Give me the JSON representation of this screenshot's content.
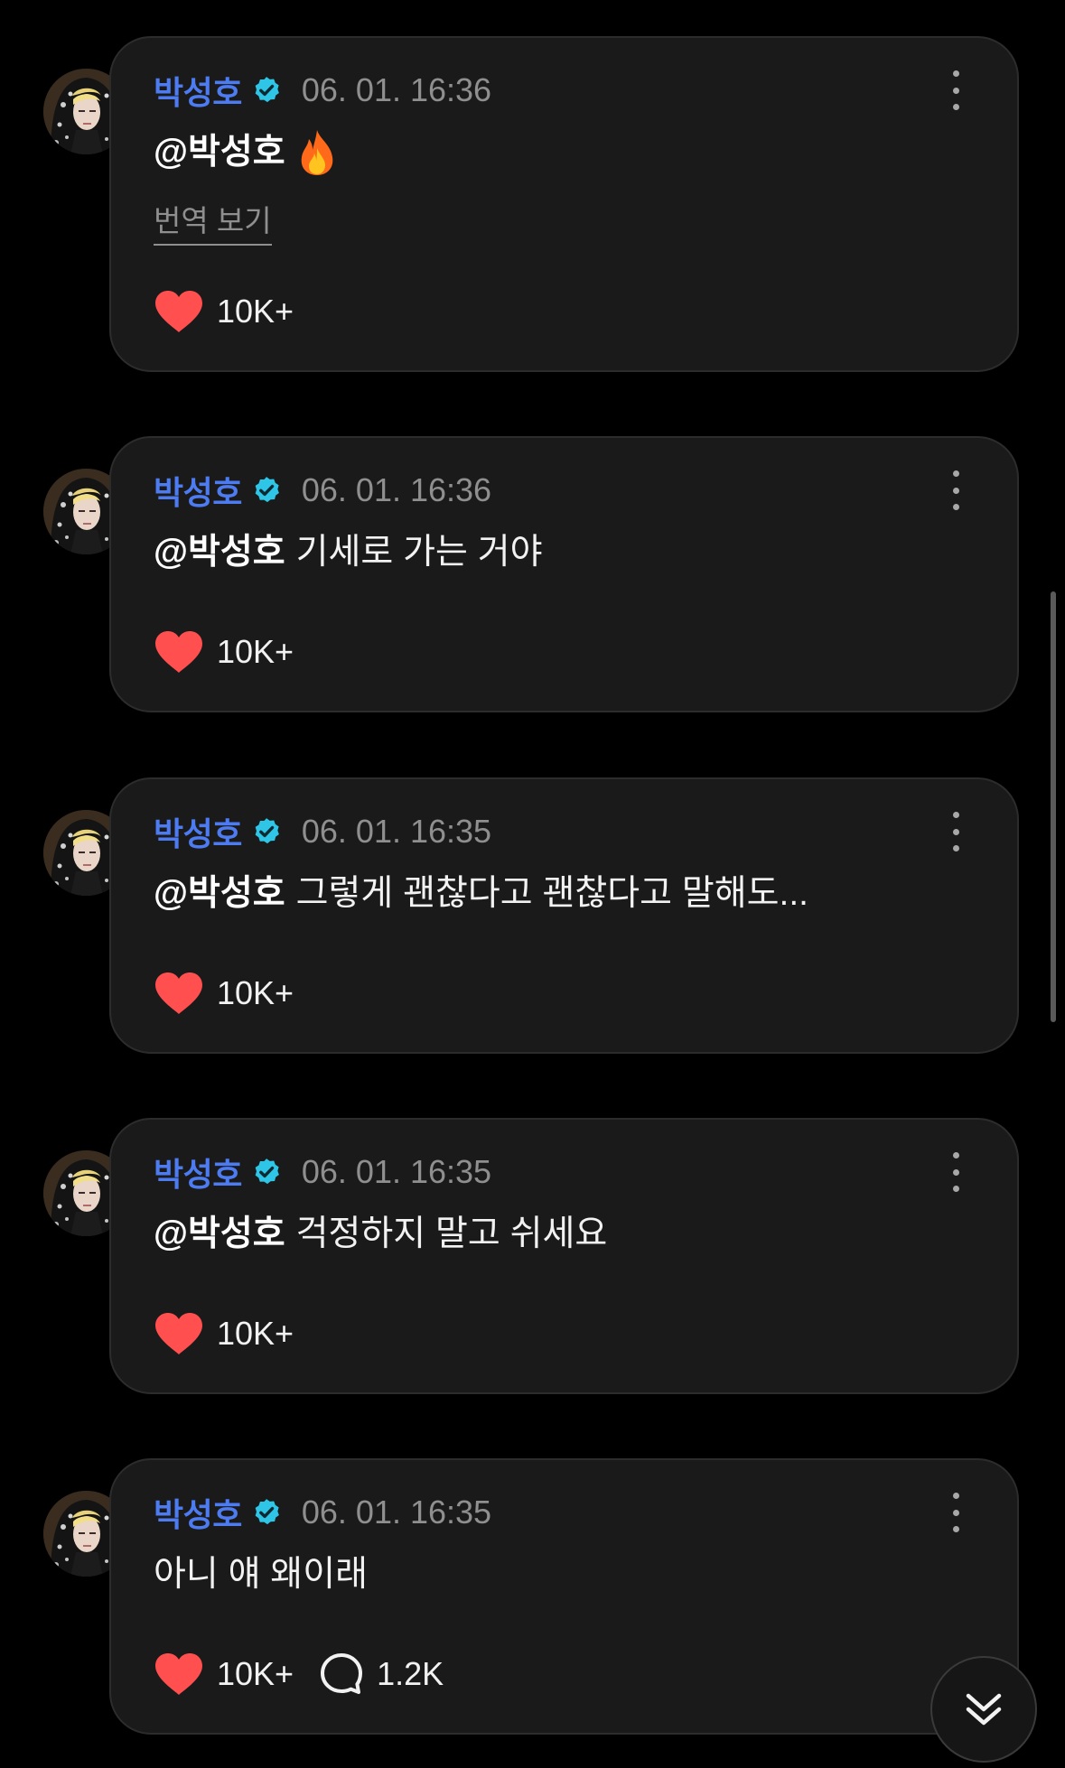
{
  "colors": {
    "background": "#000000",
    "card": "#1a1a1a",
    "author": "#4d7cf2",
    "verified": "#2ec5e6",
    "like": "#ff4f4f",
    "muted": "#8f8f8f"
  },
  "icons": {
    "verified": "verified-badge-icon",
    "more": "more-vertical-icon",
    "like": "heart-icon",
    "reply": "speech-bubble-icon",
    "scroll": "double-chevron-down-icon",
    "emoji": "fire-emoji"
  },
  "comments": [
    {
      "author": "박성호",
      "timestamp": "06. 01. 16:36",
      "mention": "@박성호",
      "text": "",
      "translate_label": "번역 보기",
      "likes": "10K+"
    },
    {
      "author": "박성호",
      "timestamp": "06. 01. 16:36",
      "mention": "@박성호",
      "text": "기세로 가는 거야",
      "likes": "10K+"
    },
    {
      "author": "박성호",
      "timestamp": "06. 01. 16:35",
      "mention": "@박성호",
      "text": "그렇게 괜찮다고 괜찮다고 말해도...",
      "likes": "10K+"
    },
    {
      "author": "박성호",
      "timestamp": "06. 01. 16:35",
      "mention": "@박성호",
      "text": "걱정하지 말고 쉬세요",
      "likes": "10K+"
    },
    {
      "author": "박성호",
      "timestamp": "06. 01. 16:35",
      "mention": "",
      "text": "아니 얘 왜이래",
      "likes": "10K+",
      "replies": "1.2K"
    }
  ]
}
